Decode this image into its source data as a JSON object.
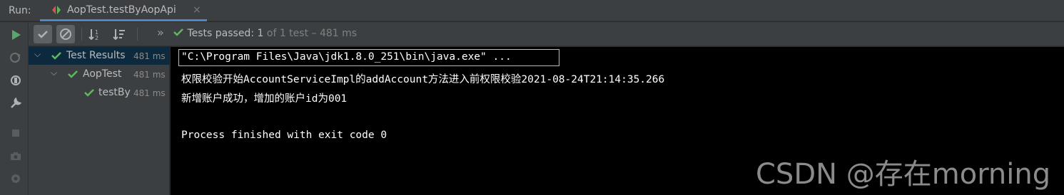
{
  "run": {
    "label": "Run:"
  },
  "tab": {
    "title": "AopTest.testByAopApi",
    "close": "×"
  },
  "toolbar": {
    "chevron": "»",
    "status_passed": "Tests passed: ",
    "status_count": "1",
    "status_rest": " of 1 test – 481 ms"
  },
  "tree": {
    "items": [
      {
        "label": "Test Results",
        "time": "481 ms",
        "expanded": true,
        "selected": true
      },
      {
        "label": "AopTest",
        "time": "481 ms",
        "expanded": true,
        "selected": false
      },
      {
        "label": "testBy",
        "time": "481 ms",
        "expanded": false,
        "selected": false
      }
    ]
  },
  "console": {
    "lines": [
      "\"C:\\Program Files\\Java\\jdk1.8.0_251\\bin\\java.exe\" ...",
      "权限校验开始AccountServiceImpl的addAccount方法进入前权限校验2021-08-24T21:14:35.266",
      "新增账户成功，增加的账户id为001",
      "",
      "Process finished with exit code 0"
    ]
  },
  "watermark": "CSDN @存在morning",
  "colors": {
    "pass_green": "#5fb85f",
    "accent_blue": "#4a88c7",
    "console_bg": "#000000"
  }
}
